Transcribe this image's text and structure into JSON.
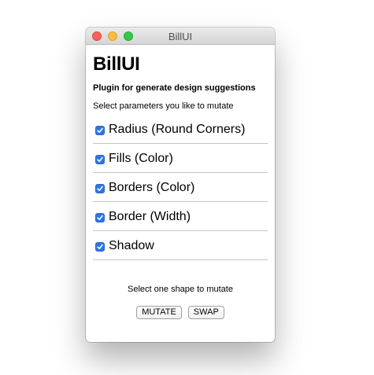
{
  "window": {
    "title": "BillUI"
  },
  "app": {
    "heading": "BillUI",
    "subtitle": "Plugin for generate design suggestions",
    "instruction": "Select parameters you like to mutate"
  },
  "parameters": [
    {
      "label": "Radius (Round Corners)",
      "checked": true
    },
    {
      "label": "Fills (Color)",
      "checked": true
    },
    {
      "label": "Borders (Color)",
      "checked": true
    },
    {
      "label": "Border (Width)",
      "checked": true
    },
    {
      "label": "Shadow",
      "checked": true
    }
  ],
  "footer": {
    "hint": "Select one shape to mutate",
    "mutate_label": "MUTATE",
    "swap_label": "SWAP"
  },
  "colors": {
    "checkbox_accent": "#2f74e6",
    "traffic_close": "#fc605b",
    "traffic_minimize": "#fdbc40",
    "traffic_zoom": "#34c84a"
  },
  "icons": {
    "checkbox": "checkmark-icon"
  }
}
